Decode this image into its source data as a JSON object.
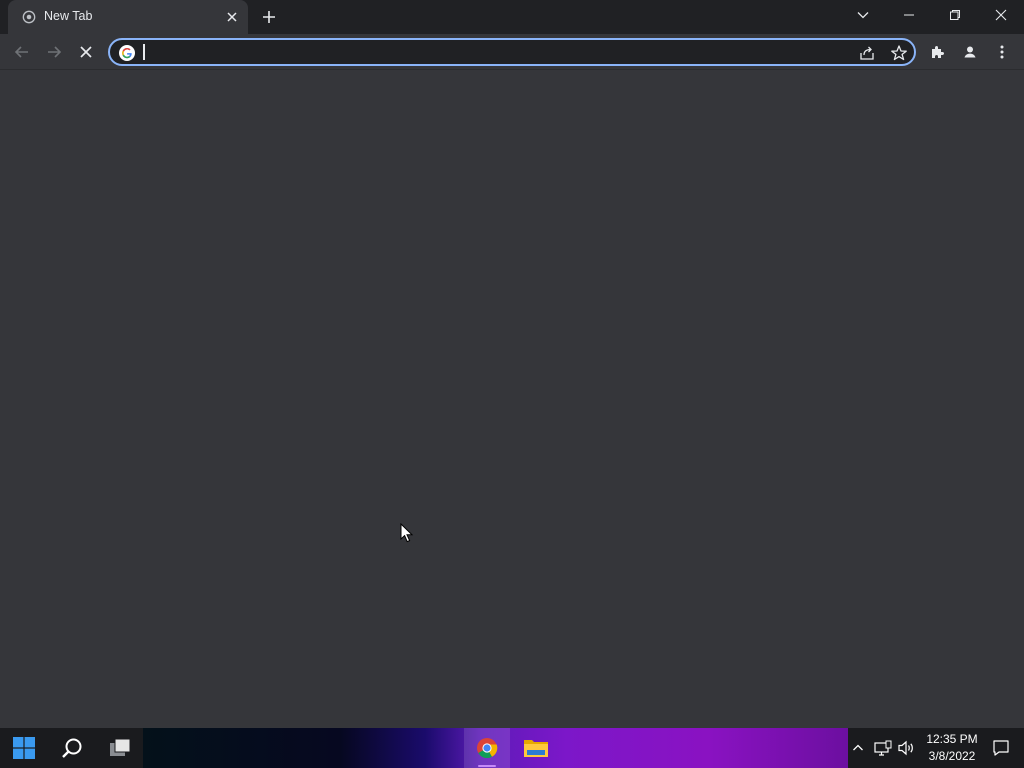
{
  "window": {
    "tab": {
      "title": "New Tab",
      "favicon": "chrome-newtab-icon",
      "close_icon": "close-icon"
    },
    "new_tab_icon": "plus-icon",
    "controls": [
      "tab-search-icon",
      "minimize-icon",
      "restore-icon",
      "close-icon"
    ]
  },
  "toolbar": {
    "back_icon": "back-arrow-icon",
    "forward_icon": "forward-arrow-icon",
    "stop_icon": "stop-loading-icon",
    "omnibox": {
      "value": "",
      "placeholder": "",
      "provider_icon": "google-icon"
    },
    "share_icon": "share-icon",
    "bookmark_icon": "star-icon",
    "extensions_icon": "puzzle-icon",
    "profile_icon": "profile-icon",
    "menu_icon": "kebab-menu-icon"
  },
  "taskbar": {
    "items": [
      "windows-start-icon",
      "search-icon",
      "task-view-icon",
      "chrome-icon",
      "file-explorer-icon"
    ],
    "tray": {
      "icons": [
        "chevron-up-icon",
        "network-icon",
        "volume-icon",
        "notification-icon"
      ],
      "time": "12:35 PM",
      "date": "3/8/2022"
    }
  },
  "colors": {
    "frame": "#202124",
    "toolbar": "#35363a",
    "focus_ring": "#8ab4f8",
    "text": "#e8eaed"
  }
}
